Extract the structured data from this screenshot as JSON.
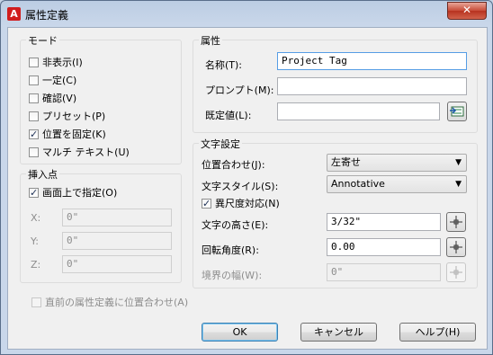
{
  "window": {
    "title": "属性定義",
    "app_icon_letter": "A",
    "close_glyph": "✕"
  },
  "mode": {
    "legend": "モード",
    "options": [
      {
        "label": "非表示(I)",
        "checked": false
      },
      {
        "label": "一定(C)",
        "checked": false
      },
      {
        "label": "確認(V)",
        "checked": false
      },
      {
        "label": "プリセット(P)",
        "checked": false
      },
      {
        "label": "位置を固定(K)",
        "checked": true
      },
      {
        "label": "マルチ テキスト(U)",
        "checked": false
      }
    ]
  },
  "insertion": {
    "legend": "挿入点",
    "specify_on_screen": {
      "label": "画面上で指定(O)",
      "checked": true
    },
    "x": {
      "label": "X:",
      "value": "0\""
    },
    "y": {
      "label": "Y:",
      "value": "0\""
    },
    "z": {
      "label": "Z:",
      "value": "0\""
    }
  },
  "attribute": {
    "legend": "属性",
    "tag": {
      "label": "名称(T):",
      "value": "Project Tag"
    },
    "prompt": {
      "label": "プロンプト(M):",
      "value": ""
    },
    "default": {
      "label": "既定値(L):",
      "value": ""
    }
  },
  "text_settings": {
    "legend": "文字設定",
    "justification": {
      "label": "位置合わせ(J):",
      "value": "左寄せ"
    },
    "text_style": {
      "label": "文字スタイル(S):",
      "value": "Annotative"
    },
    "annotative": {
      "label": "異尺度対応(N)",
      "checked": true
    },
    "text_height": {
      "label": "文字の高さ(E):",
      "value": "3/32\""
    },
    "rotation": {
      "label": "回転角度(R):",
      "value": "0.00"
    },
    "boundary_width": {
      "label": "境界の幅(W):",
      "value": "0\""
    }
  },
  "align_below": {
    "label": "直前の属性定義に位置合わせ(A)",
    "checked": false
  },
  "buttons": {
    "ok": "OK",
    "cancel": "キャンセル",
    "help": "ヘルプ(H)"
  }
}
